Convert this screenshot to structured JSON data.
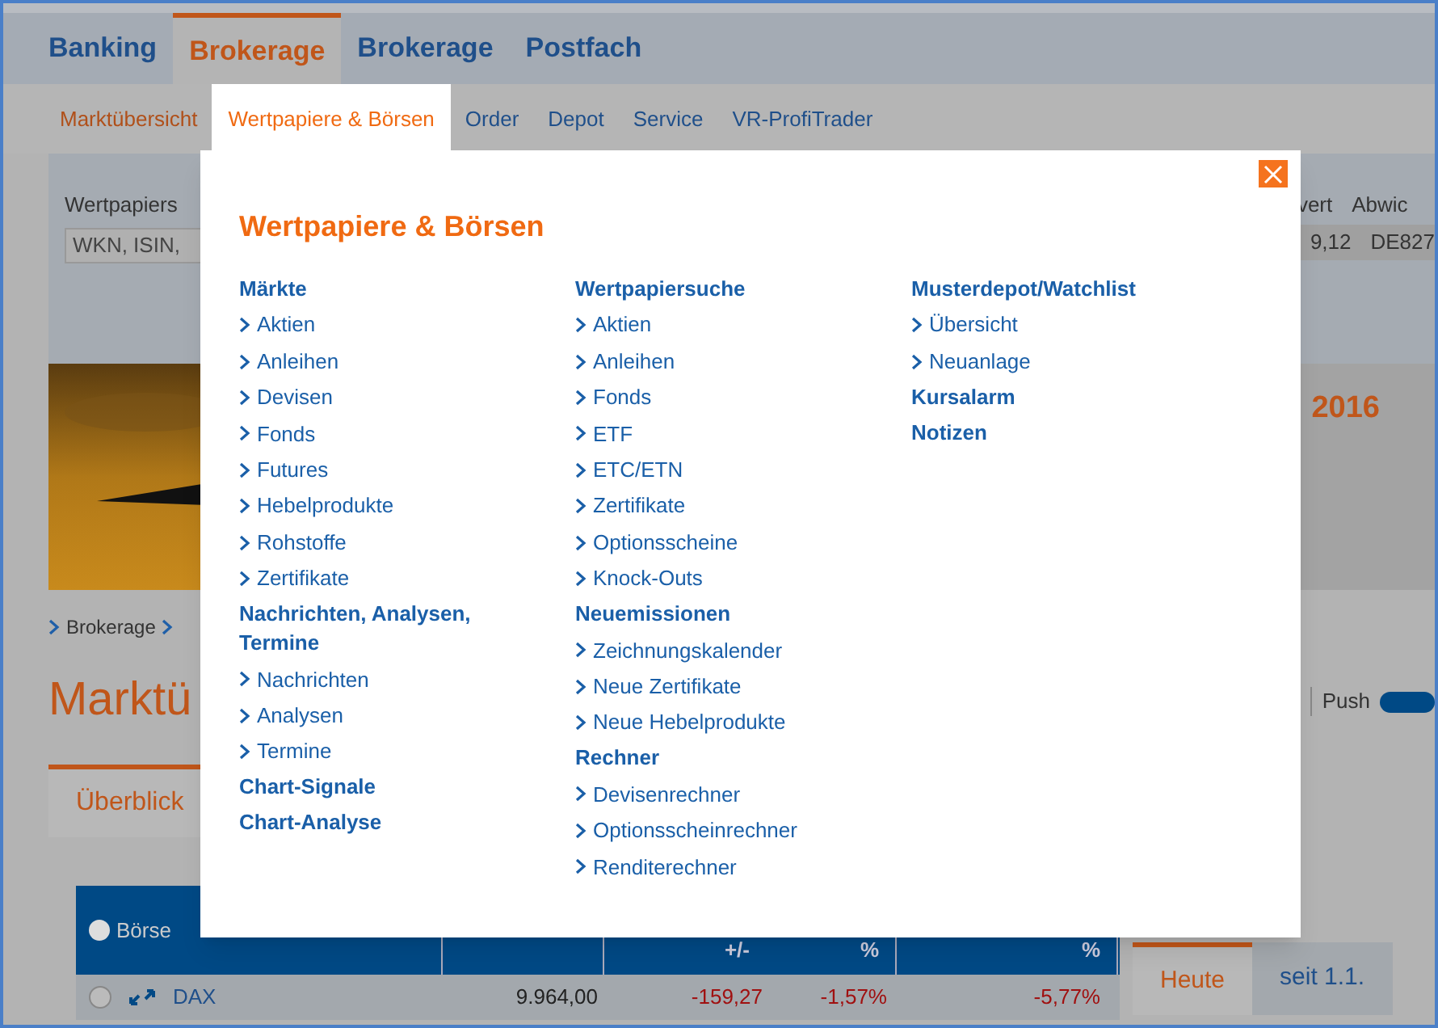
{
  "main_nav": [
    {
      "label": "Banking",
      "selected": false
    },
    {
      "label": "Brokerage",
      "selected": true
    },
    {
      "label": "Brokerage",
      "selected": false
    },
    {
      "label": "Postfach",
      "selected": false
    }
  ],
  "sub_nav": [
    {
      "label": "Marktübersicht",
      "selected": false
    },
    {
      "label": "Wertpapiere & Börsen",
      "selected": true
    },
    {
      "label": "Order",
      "selected": false
    },
    {
      "label": "Depot",
      "selected": false
    },
    {
      "label": "Service",
      "selected": false
    },
    {
      "label": "VR-ProfiTrader",
      "selected": false
    }
  ],
  "search": {
    "label": "Wertpapiers",
    "placeholder": "WKN, ISIN,"
  },
  "quote_strip": {
    "columns": [
      "vert",
      "Abwic"
    ],
    "values": [
      "9,12",
      "DE827"
    ]
  },
  "banner": {
    "kind": "picture",
    "headline": "2016"
  },
  "breadcrumb": [
    "Brokerage"
  ],
  "page_title": "Marktü",
  "push": {
    "label": "Push",
    "on": true
  },
  "tabs": [
    {
      "label": "Überblick",
      "selected": true
    }
  ],
  "period_tabs": [
    {
      "label": "Heute",
      "selected": true
    },
    {
      "label": "seit 1.1.",
      "selected": false
    }
  ],
  "table": {
    "radio": {
      "label": "Börse",
      "selected": false
    },
    "columns": [
      "+/-",
      "%",
      "%"
    ],
    "rows": [
      {
        "name": "DAX",
        "value": "9.964,00",
        "change": "-159,27",
        "change_pct": "-1,57%",
        "ytd_pct": "-5,77%"
      }
    ]
  },
  "modal": {
    "title": "Wertpapiere & Börsen",
    "columns": [
      [
        {
          "heading": "Märkte",
          "links": [
            "Aktien",
            "Anleihen",
            "Devisen",
            "Fonds",
            "Futures",
            "Hebelprodukte",
            "Rohstoffe",
            "Zertifikate"
          ]
        },
        {
          "heading": "Nachrichten, Analysen, Termine",
          "links": [
            "Nachrichten",
            "Analysen",
            "Termine"
          ]
        },
        {
          "heading": "Chart-Signale"
        },
        {
          "heading": "Chart-Analyse"
        }
      ],
      [
        {
          "heading": "Wertpapiersuche",
          "links": [
            "Aktien",
            "Anleihen",
            "Fonds",
            "ETF",
            "ETC/ETN",
            "Zertifikate",
            "Optionsscheine",
            "Knock-Outs"
          ]
        },
        {
          "heading": "Neuemissionen",
          "links": [
            "Zeichnungskalender",
            "Neue Zertifikate",
            "Neue Hebelprodukte"
          ]
        },
        {
          "heading": "Rechner",
          "links": [
            "Devisenrechner",
            "Optionsscheinrechner",
            "Renditerechner"
          ]
        }
      ],
      [
        {
          "heading": "Musterdepot/Watchlist",
          "links": [
            "Übersicht",
            "Neuanlage"
          ]
        },
        {
          "heading": "Kursalarm"
        },
        {
          "heading": "Notizen"
        }
      ]
    ]
  }
}
